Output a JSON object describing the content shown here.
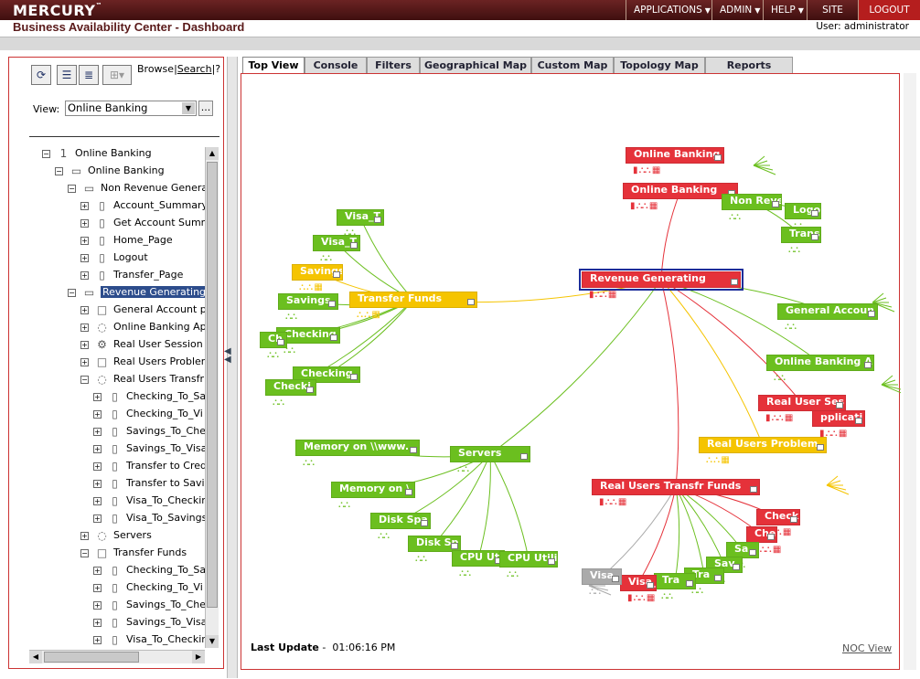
{
  "header": {
    "brand": "MERCURY",
    "brand_tm": "™",
    "title": "Business Availability Center - Dashboard",
    "user": "User: administrator",
    "nav": [
      {
        "label": "APPLICATIONS",
        "dropdown": true
      },
      {
        "label": "ADMIN",
        "dropdown": true
      },
      {
        "label": "HELP",
        "dropdown": true
      },
      {
        "label": "SITE MAP",
        "dropdown": false
      },
      {
        "label": "LOGOUT",
        "dropdown": false
      }
    ]
  },
  "left": {
    "browse": "Browse",
    "sep1": "|",
    "search": "Search",
    "sep2": "|",
    "help": "?",
    "view_label": "View:",
    "view_value": "Online Banking",
    "view_more": "...",
    "tree": [
      {
        "level": 0,
        "exp": "−",
        "icon": "1",
        "label": "Online Banking"
      },
      {
        "level": 1,
        "exp": "−",
        "icon": "▭",
        "label": "Online Banking"
      },
      {
        "level": 2,
        "exp": "−",
        "icon": "▭",
        "label": "Non Revenue Genera"
      },
      {
        "level": 3,
        "exp": "+",
        "icon": "▯",
        "label": "Account_Summary"
      },
      {
        "level": 3,
        "exp": "+",
        "icon": "▯",
        "label": "Get Account Summ"
      },
      {
        "level": 3,
        "exp": "+",
        "icon": "▯",
        "label": "Home_Page"
      },
      {
        "level": 3,
        "exp": "+",
        "icon": "▯",
        "label": "Logout"
      },
      {
        "level": 3,
        "exp": "+",
        "icon": "▯",
        "label": "Transfer_Page"
      },
      {
        "level": 2,
        "exp": "−",
        "icon": "▭",
        "label": "Revenue Generating",
        "selected": true
      },
      {
        "level": 3,
        "exp": "+",
        "icon": "□",
        "label": "General Account p"
      },
      {
        "level": 3,
        "exp": "+",
        "icon": "◌",
        "label": "Online Banking Ap"
      },
      {
        "level": 3,
        "exp": "+",
        "icon": "⚙",
        "label": "Real User Session"
      },
      {
        "level": 3,
        "exp": "+",
        "icon": "□",
        "label": "Real Users Probler"
      },
      {
        "level": 3,
        "exp": "−",
        "icon": "◌",
        "label": "Real Users Transfr"
      },
      {
        "level": 4,
        "exp": "+",
        "icon": "▯",
        "label": "Checking_To_Sa"
      },
      {
        "level": 4,
        "exp": "+",
        "icon": "▯",
        "label": "Checking_To_Vi"
      },
      {
        "level": 4,
        "exp": "+",
        "icon": "▯",
        "label": "Savings_To_Che"
      },
      {
        "level": 4,
        "exp": "+",
        "icon": "▯",
        "label": "Savings_To_Visa"
      },
      {
        "level": 4,
        "exp": "+",
        "icon": "▯",
        "label": "Transfer to Cred"
      },
      {
        "level": 4,
        "exp": "+",
        "icon": "▯",
        "label": "Transfer to Savi"
      },
      {
        "level": 4,
        "exp": "+",
        "icon": "▯",
        "label": "Visa_To_Checkir"
      },
      {
        "level": 4,
        "exp": "+",
        "icon": "▯",
        "label": "Visa_To_Savings"
      },
      {
        "level": 3,
        "exp": "+",
        "icon": "◌",
        "label": "Servers"
      },
      {
        "level": 3,
        "exp": "−",
        "icon": "□",
        "label": "Transfer Funds"
      },
      {
        "level": 4,
        "exp": "+",
        "icon": "▯",
        "label": "Checking_To_Sa"
      },
      {
        "level": 4,
        "exp": "+",
        "icon": "▯",
        "label": "Checking_To_Vi"
      },
      {
        "level": 4,
        "exp": "+",
        "icon": "▯",
        "label": "Savings_To_Che"
      },
      {
        "level": 4,
        "exp": "+",
        "icon": "▯",
        "label": "Savings_To_Visa"
      },
      {
        "level": 4,
        "exp": "+",
        "icon": "▯",
        "label": "Visa_To_Checkir"
      }
    ]
  },
  "tabs": [
    "Top View",
    "Console",
    "Filters",
    "Geographical Map",
    "Custom Map",
    "Topology Map",
    "Reports"
  ],
  "active_tab": "Top View",
  "map": {
    "nodes": [
      {
        "id": "ob_top",
        "label": "Online Banking",
        "color": "red"
      },
      {
        "id": "ob",
        "label": "Online Banking",
        "color": "red"
      },
      {
        "id": "nonrev",
        "label": "Non Reve",
        "color": "green"
      },
      {
        "id": "logo",
        "label": "Logo",
        "color": "green"
      },
      {
        "id": "trans",
        "label": "Trans",
        "color": "green"
      },
      {
        "id": "revgen",
        "label": "Revenue Generating",
        "color": "red"
      },
      {
        "id": "general",
        "label": "General Accoun",
        "color": "green"
      },
      {
        "id": "obapp",
        "label": "Online Banking A",
        "color": "green"
      },
      {
        "id": "rus",
        "label": "Real User Ses",
        "color": "red"
      },
      {
        "id": "applicati",
        "label": "pplicati",
        "color": "red"
      },
      {
        "id": "rup",
        "label": "Real Users Problem",
        "color": "yellow"
      },
      {
        "id": "rutf",
        "label": "Real Users Transfr Funds",
        "color": "red"
      },
      {
        "id": "check1",
        "label": "Check",
        "color": "red"
      },
      {
        "id": "che2",
        "label": "Che",
        "color": "red"
      },
      {
        "id": "sa1",
        "label": "Sa",
        "color": "green"
      },
      {
        "id": "sav",
        "label": "Sav",
        "color": "green"
      },
      {
        "id": "tra1",
        "label": "Tra",
        "color": "green"
      },
      {
        "id": "tra2",
        "label": "Tra",
        "color": "green"
      },
      {
        "id": "visa_r",
        "label": "Visa_",
        "color": "red"
      },
      {
        "id": "visa_g",
        "label": "Visa_",
        "color": "grey"
      },
      {
        "id": "servers",
        "label": "Servers",
        "color": "green"
      },
      {
        "id": "mem1",
        "label": "Memory on \\\\www.",
        "color": "green"
      },
      {
        "id": "mem2",
        "label": "Memory on \\",
        "color": "green"
      },
      {
        "id": "disk1",
        "label": "Disk Spa",
        "color": "green"
      },
      {
        "id": "disk2",
        "label": "Disk Sp",
        "color": "green"
      },
      {
        "id": "cpu1",
        "label": "CPU Uti",
        "color": "green"
      },
      {
        "id": "cpu2",
        "label": "CPU Utili",
        "color": "green"
      },
      {
        "id": "tf",
        "label": "Transfer Funds",
        "color": "yellow"
      },
      {
        "id": "visa_t1",
        "label": "Visa_T",
        "color": "green"
      },
      {
        "id": "visa_t2",
        "label": "Visa_T",
        "color": "green"
      },
      {
        "id": "savings_y",
        "label": "Savings",
        "color": "yellow"
      },
      {
        "id": "savings_g",
        "label": "Savings",
        "color": "green"
      },
      {
        "id": "checking1",
        "label": "Checking",
        "color": "green"
      },
      {
        "id": "ch",
        "label": "Ch",
        "color": "green"
      },
      {
        "id": "checking2",
        "label": "Checking",
        "color": "green"
      },
      {
        "id": "checki",
        "label": "Checki",
        "color": "green"
      }
    ],
    "last_update_label": "Last Update",
    "last_update_sep": "-",
    "last_update_time": "01:06:16 PM",
    "noc_view": "NOC View"
  },
  "colors": {
    "red": "#e5323a",
    "green": "#6bbf1f",
    "yellow": "#f5c400",
    "grey": "#aaaaaa",
    "header": "#5a1a1a",
    "accent_border": "#cc3333"
  }
}
